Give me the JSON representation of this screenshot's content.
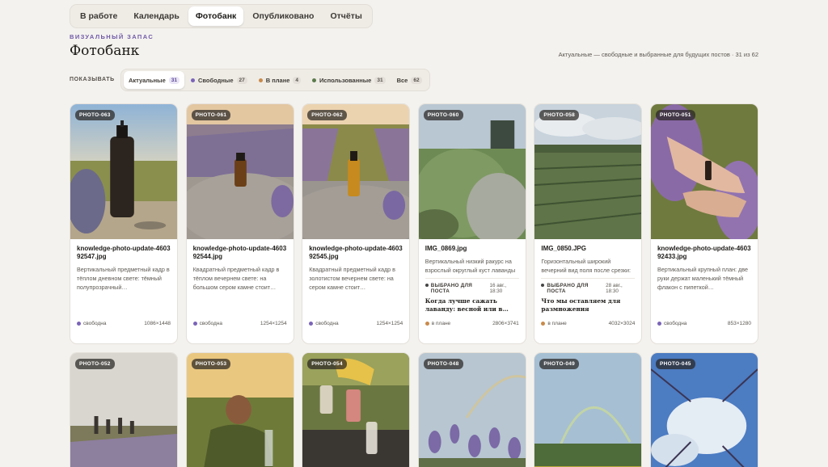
{
  "nav": {
    "tabs": [
      {
        "label": "В работе"
      },
      {
        "label": "Календарь"
      },
      {
        "label": "Фотобанк"
      },
      {
        "label": "Опубликовано"
      },
      {
        "label": "Отчёты"
      }
    ],
    "active_index": 2
  },
  "header": {
    "eyebrow": "ВИЗУАЛЬНЫЙ ЗАПАС",
    "title": "Фотобанк",
    "summary": "Актуальные — свободные и выбранные для будущих постов · 31 из 62"
  },
  "filters": {
    "label": "ПОКАЗЫВАТЬ",
    "chips": [
      {
        "label": "Актуальные",
        "count": "31",
        "dot": ""
      },
      {
        "label": "Свободные",
        "count": "27",
        "dot": "#7a64b8"
      },
      {
        "label": "В плане",
        "count": "4",
        "dot": "#c98a4b"
      },
      {
        "label": "Использованные",
        "count": "31",
        "dot": "#5b7a4c"
      },
      {
        "label": "Все",
        "count": "62",
        "dot": ""
      }
    ]
  },
  "cards": [
    {
      "badge": "PHOTO-063",
      "file": "knowledge-photo-update-460392547.jpg",
      "desc": "Вертикальный предметный кадр в тёплом дневном свете: тёмный полупрозрачный…",
      "status": "свободна",
      "dims": "1086×1448"
    },
    {
      "badge": "PHOTO-061",
      "file": "knowledge-photo-update-460392544.jpg",
      "desc": "Квадратный предметный кадр в тёплом вечернем свете: на большом сером камне стоит…",
      "status": "свободна",
      "dims": "1254×1254"
    },
    {
      "badge": "PHOTO-062",
      "file": "knowledge-photo-update-460392545.jpg",
      "desc": "Квадратный предметный кадр в золотистом вечернем свете: на сером камне стоит…",
      "status": "свободна",
      "dims": "1254×1254"
    },
    {
      "badge": "PHOTO-060",
      "file": "IMG_0869.jpg",
      "desc": "Вертикальный низкий ракурс на взрослый округлый куст лаванды после срезки; на…",
      "sched_label": "ВЫБРАНО ДЛЯ ПОСТА",
      "sched_date": "16 авг., 18:30",
      "post_title": "Когда лучше сажать лаванду: весной или в…",
      "status": "в плане",
      "dims": "2806×3741"
    },
    {
      "badge": "PHOTO-058",
      "file": "IMG_0850.JPG",
      "desc": "Горизонтальный широкий вечерний вид поля после срезки: многочисленные…",
      "sched_label": "ВЫБРАНО ДЛЯ ПОСТА",
      "sched_date": "28 авг., 18:30",
      "post_title": "Что мы оставляем для размножения",
      "status": "в плане",
      "dims": "4032×3024"
    },
    {
      "badge": "PHOTO-051",
      "file": "knowledge-photo-update-460392433.jpg",
      "desc": "Вертикальный крупный план: две руки держат маленький тёмный флакон с пипеткой…",
      "status": "свободна",
      "dims": "853×1280"
    },
    {
      "badge": "PHOTO-052"
    },
    {
      "badge": "PHOTO-053"
    },
    {
      "badge": "PHOTO-054"
    },
    {
      "badge": "PHOTO-048"
    },
    {
      "badge": "PHOTO-049"
    },
    {
      "badge": "PHOTO-045"
    }
  ],
  "colors": {
    "accent": "#6f5aa8",
    "free": "#7a64b8",
    "planned": "#c98a4b",
    "used": "#5b7a4c"
  }
}
